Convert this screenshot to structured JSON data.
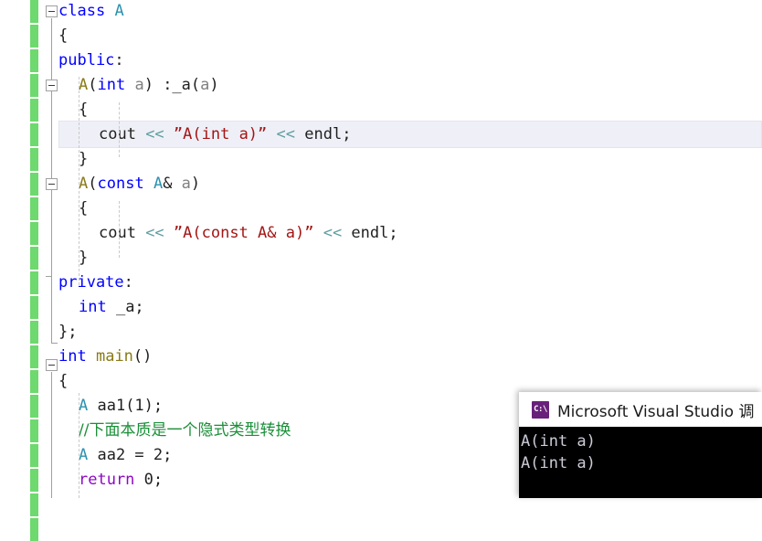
{
  "editor": {
    "font_size_px": 17,
    "line_height_px": 27,
    "current_line_index": 4,
    "change_bar_color": "#6ed96e",
    "current_line_bg": "#eff0f7",
    "lines": [
      {
        "index": 0,
        "indent": 0,
        "text": "class A",
        "outline": "collapse"
      },
      {
        "index": 1,
        "indent": 0,
        "text": "{"
      },
      {
        "index": 2,
        "indent": 0,
        "text": "public:"
      },
      {
        "index": 3,
        "indent": 1,
        "text": "A(int a) :_a(a)",
        "outline": "collapse"
      },
      {
        "index": 4,
        "indent": 1,
        "text": "{"
      },
      {
        "index": 5,
        "indent": 2,
        "text": "cout << ”A(int a)” << endl;"
      },
      {
        "index": 6,
        "indent": 1,
        "text": "}"
      },
      {
        "index": 7,
        "indent": 1,
        "text": "A(const A& a)",
        "outline": "collapse"
      },
      {
        "index": 8,
        "indent": 1,
        "text": "{"
      },
      {
        "index": 9,
        "indent": 2,
        "text": "cout << ”A(const A& a)” << endl;"
      },
      {
        "index": 10,
        "indent": 1,
        "text": "}"
      },
      {
        "index": 11,
        "indent": 0,
        "text": "private:"
      },
      {
        "index": 12,
        "indent": 1,
        "text": "int _a;"
      },
      {
        "index": 13,
        "indent": 0,
        "text": "};"
      },
      {
        "index": 14,
        "indent": 0,
        "text": "int main()",
        "outline": "collapse"
      },
      {
        "index": 15,
        "indent": 0,
        "text": "{"
      },
      {
        "index": 16,
        "indent": 1,
        "text": "A aa1(1);"
      },
      {
        "index": 17,
        "indent": 1,
        "text": "//下面本质是一个隐式类型转换"
      },
      {
        "index": 18,
        "indent": 1,
        "text": "A aa2 = 2;"
      },
      {
        "index": 19,
        "indent": 1,
        "text": "return 0;"
      }
    ],
    "tokens": {
      "l0": [
        {
          "t": "class",
          "c": "k"
        },
        {
          "t": " ",
          "c": "plain"
        },
        {
          "t": "A",
          "c": "typ"
        }
      ],
      "l1": [
        {
          "t": "{",
          "c": "plain"
        }
      ],
      "l2": [
        {
          "t": "public",
          "c": "k"
        },
        {
          "t": ":",
          "c": "plain"
        }
      ],
      "l3": [
        {
          "t": "A",
          "c": "fn"
        },
        {
          "t": "(",
          "c": "plain"
        },
        {
          "t": "int",
          "c": "k"
        },
        {
          "t": " ",
          "c": "plain"
        },
        {
          "t": "a",
          "c": "id"
        },
        {
          "t": ") :_a(",
          "c": "plain"
        },
        {
          "t": "a",
          "c": "id"
        },
        {
          "t": ")",
          "c": "plain"
        }
      ],
      "l4": [
        {
          "t": "{",
          "c": "plain"
        }
      ],
      "l5": [
        {
          "t": "cout ",
          "c": "plain"
        },
        {
          "t": "<<",
          "c": "op"
        },
        {
          "t": " ",
          "c": "plain"
        },
        {
          "t": "”A(int a)”",
          "c": "str"
        },
        {
          "t": " ",
          "c": "plain"
        },
        {
          "t": "<<",
          "c": "op"
        },
        {
          "t": " endl;",
          "c": "plain"
        }
      ],
      "l6": [
        {
          "t": "}",
          "c": "plain"
        }
      ],
      "l7": [
        {
          "t": "A",
          "c": "fn"
        },
        {
          "t": "(",
          "c": "plain"
        },
        {
          "t": "const",
          "c": "k"
        },
        {
          "t": " ",
          "c": "plain"
        },
        {
          "t": "A",
          "c": "typ"
        },
        {
          "t": "& ",
          "c": "plain"
        },
        {
          "t": "a",
          "c": "id"
        },
        {
          "t": ")",
          "c": "plain"
        }
      ],
      "l8": [
        {
          "t": "{",
          "c": "plain"
        }
      ],
      "l9": [
        {
          "t": "cout ",
          "c": "plain"
        },
        {
          "t": "<<",
          "c": "op"
        },
        {
          "t": " ",
          "c": "plain"
        },
        {
          "t": "”A(const A& a)”",
          "c": "str"
        },
        {
          "t": " ",
          "c": "plain"
        },
        {
          "t": "<<",
          "c": "op"
        },
        {
          "t": " endl;",
          "c": "plain"
        }
      ],
      "l10": [
        {
          "t": "}",
          "c": "plain"
        }
      ],
      "l11": [
        {
          "t": "private",
          "c": "k"
        },
        {
          "t": ":",
          "c": "plain"
        }
      ],
      "l12": [
        {
          "t": "int",
          "c": "k"
        },
        {
          "t": " _a;",
          "c": "plain"
        }
      ],
      "l13": [
        {
          "t": "};",
          "c": "plain"
        }
      ],
      "l14": [
        {
          "t": "int",
          "c": "k"
        },
        {
          "t": " ",
          "c": "plain"
        },
        {
          "t": "main",
          "c": "fn"
        },
        {
          "t": "()",
          "c": "plain"
        }
      ],
      "l15": [
        {
          "t": "{",
          "c": "plain"
        }
      ],
      "l16": [
        {
          "t": "A",
          "c": "typ"
        },
        {
          "t": " aa1(1);",
          "c": "plain"
        }
      ],
      "l17": [
        {
          "t": "//下面本质是一个隐式类型转换",
          "c": "cmt"
        }
      ],
      "l18": [
        {
          "t": "A",
          "c": "typ"
        },
        {
          "t": " aa2 = 2;",
          "c": "plain"
        }
      ],
      "l19": [
        {
          "t": "return",
          "c": "ctl"
        },
        {
          "t": " 0;",
          "c": "plain"
        }
      ]
    }
  },
  "console": {
    "icon": "console-window-icon",
    "icon_glyph": "C:\\",
    "icon_color": "#68217a",
    "title": "Microsoft Visual Studio 调",
    "output_lines": [
      "A(int a)",
      "A(int a)"
    ],
    "background": "#000000",
    "text_color": "#ccccd8"
  }
}
